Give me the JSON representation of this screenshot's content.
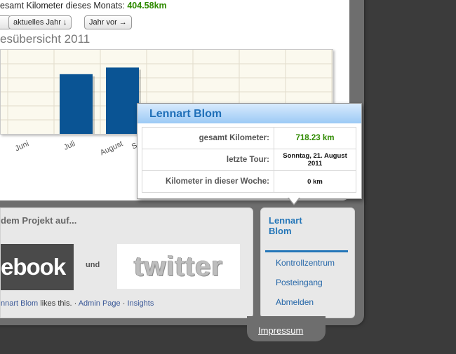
{
  "header": {
    "month_label": "esamt Kilometer dieses Monats:",
    "month_value": "404.58km"
  },
  "controls": {
    "prev_button": "",
    "current_year_button": "aktuelles Jahr ↓",
    "next_year_button": "Jahr vor →"
  },
  "chart_data": {
    "type": "bar",
    "title": "esübersicht 2011",
    "categories": [
      "Juni",
      "Juli",
      "August",
      "Se"
    ],
    "values": [
      0,
      404.58,
      449.57,
      0
    ],
    "ylim": [
      0,
      570
    ],
    "grid": true
  },
  "popup": {
    "name": "Lennart Blom",
    "rows": [
      {
        "label": "gesamt Kilometer:",
        "value": "718.23 km"
      },
      {
        "label": "letzte Tour:",
        "value": "Sonntag, 21. August 2011"
      },
      {
        "label": "Kilometer in dieser Woche:",
        "value": "0 km"
      }
    ]
  },
  "social": {
    "follow_text": "dem Projekt auf...",
    "facebook_logo": "ebook",
    "and_text": "und",
    "twitter_logo": "twitter",
    "likes_name": "nnart Blom",
    "likes_text": "likes this.",
    "separator": "·",
    "admin_link": "Admin Page",
    "insights_link": "Insights"
  },
  "user_menu": {
    "name_line1": "Lennart",
    "name_line2": "Blom",
    "items": [
      "Kontrollzentrum",
      "Posteingang",
      "Abmelden"
    ]
  },
  "footer": {
    "impressum": "Impressum"
  }
}
